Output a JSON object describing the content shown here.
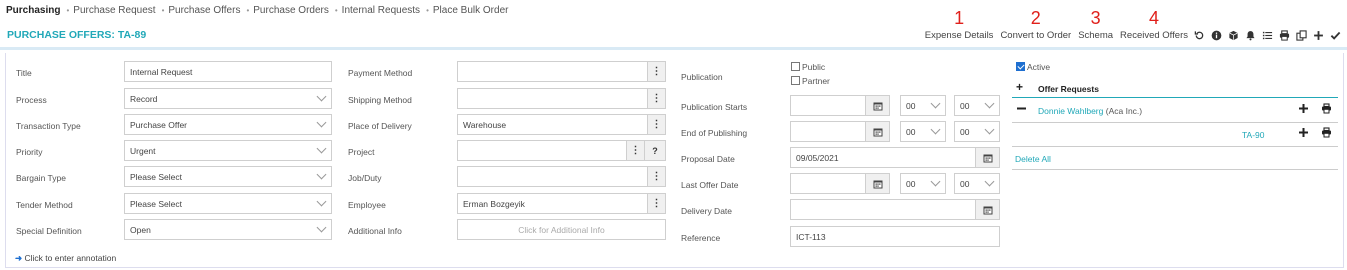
{
  "breadcrumb": {
    "items": [
      "Purchasing",
      "Purchase Request",
      "Purchase Offers",
      "Purchase Orders",
      "Internal Requests",
      "Place Bulk Order"
    ]
  },
  "page_title": "PURCHASE OFFERS: TA-89",
  "toolbar": {
    "buttons": [
      {
        "label": "Expense Details",
        "num": "1"
      },
      {
        "label": "Convert to Order",
        "num": "2"
      },
      {
        "label": "Schema",
        "num": "3"
      },
      {
        "label": "Received Offers",
        "num": "4"
      }
    ],
    "icons": [
      "history-icon",
      "info-icon",
      "cube-icon",
      "bell-icon",
      "list-icon",
      "print-icon",
      "copy-icon",
      "add-icon",
      "check-icon"
    ]
  },
  "col1": {
    "title": {
      "label": "Title",
      "value": "Internal Request"
    },
    "process": {
      "label": "Process",
      "value": "Record"
    },
    "transaction_type": {
      "label": "Transaction Type",
      "value": "Purchase Offer"
    },
    "priority": {
      "label": "Priority",
      "value": "Urgent"
    },
    "bargain_type": {
      "label": "Bargain Type",
      "value": "Please Select"
    },
    "tender_method": {
      "label": "Tender Method",
      "value": "Please Select"
    },
    "special_definition": {
      "label": "Special Definition",
      "value": "Open"
    }
  },
  "col2": {
    "payment_method": {
      "label": "Payment Method",
      "value": ""
    },
    "shipping_method": {
      "label": "Shipping Method",
      "value": ""
    },
    "place_of_delivery": {
      "label": "Place of Delivery",
      "value": "Warehouse"
    },
    "project": {
      "label": "Project",
      "value": "",
      "help": "?"
    },
    "job_duty": {
      "label": "Job/Duty",
      "value": ""
    },
    "employee": {
      "label": "Employee",
      "value": "Erman Bozgeyik"
    },
    "additional_info": {
      "label": "Additional Info",
      "placeholder": "Click for Additional Info"
    }
  },
  "col3": {
    "publication": {
      "label": "Publication",
      "public": "Public",
      "partner": "Partner",
      "public_checked": false,
      "partner_checked": false
    },
    "publication_starts": {
      "label": "Publication Starts",
      "date": "",
      "hour": "00",
      "minute": "00"
    },
    "end_of_publishing": {
      "label": "End of Publishing",
      "date": "",
      "hour": "00",
      "minute": "00"
    },
    "proposal_date": {
      "label": "Proposal Date",
      "value": "09/05/2021"
    },
    "last_offer_date": {
      "label": "Last Offer Date",
      "date": "",
      "hour": "00",
      "minute": "00"
    },
    "delivery_date": {
      "label": "Delivery Date",
      "value": ""
    },
    "reference": {
      "label": "Reference",
      "value": "ICT-113"
    }
  },
  "col4": {
    "active": {
      "label": "Active",
      "checked": true
    },
    "offer_requests": {
      "label": "Offer Requests",
      "add": "+"
    },
    "rows": [
      {
        "name": "Donnie Wahlberg",
        "company": "(Aca Inc.)"
      },
      {
        "code": "TA-90"
      }
    ],
    "delete_all": "Delete All"
  },
  "annotation": "Click to enter annotation",
  "colors": {
    "accent": "#21a8b8",
    "number_red": "#e0201b",
    "checkbox_blue": "#1e6fd0"
  }
}
